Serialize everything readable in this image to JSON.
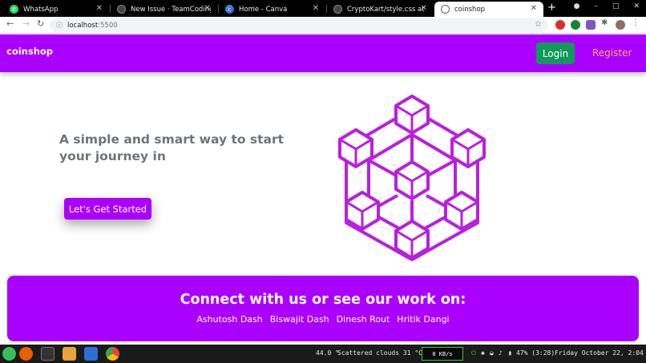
{
  "browser": {
    "tabs": [
      {
        "title": "WhatsApp",
        "active": false
      },
      {
        "title": "New Issue · TeamCodingMo",
        "active": false
      },
      {
        "title": "Home - Canva",
        "active": false
      },
      {
        "title": "CryptoKart/style.css at ma",
        "active": false
      },
      {
        "title": "coinshop",
        "active": true
      }
    ],
    "new_tab": "+",
    "url_host": "localhost",
    "url_port": ":5500"
  },
  "site": {
    "brand": "coinshop",
    "login_label": "Login",
    "register_label": "Register",
    "hero_text": "A simple and smart way to start your journey in",
    "cta_label": "Let's Get Started",
    "footer_heading": "Connect with us or see our work on:",
    "footer_links": [
      "Ashutosh Dash",
      "Biswajit Dash",
      "Dinesh Rout",
      "Hritik Dangi"
    ]
  },
  "taskbar": {
    "temp": "44.0 °",
    "weather": "Scattered clouds 31 °C",
    "net_speed": "0 KB/s",
    "battery": "47% (3:28)",
    "datetime": "Friday October 22,  2:04 PM"
  },
  "colors": {
    "brand_purple": "#aa00ff",
    "login_green": "#109a59",
    "register_orange": "#ffa85c",
    "hero_text_gray": "#6c757d"
  }
}
